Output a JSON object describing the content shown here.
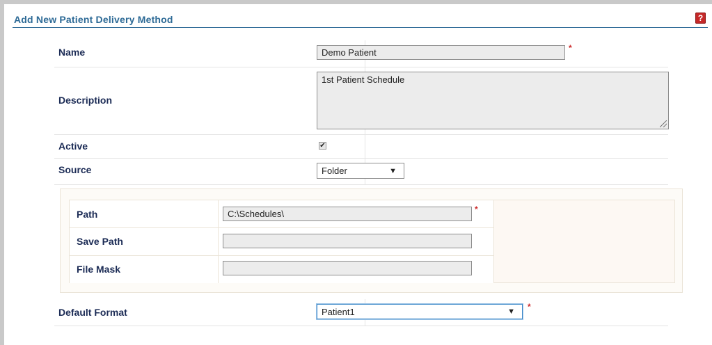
{
  "header": {
    "title": "Add New Patient Delivery Method",
    "help_icon": "question-mark",
    "help_glyph": "?"
  },
  "form": {
    "name": {
      "label": "Name",
      "value": "Demo Patient",
      "required": true
    },
    "description": {
      "label": "Description",
      "value": "1st Patient Schedule"
    },
    "active": {
      "label": "Active",
      "checked": true
    },
    "source": {
      "label": "Source",
      "selected": "Folder"
    },
    "path": {
      "label": "Path",
      "value": "C:\\Schedules\\",
      "required": true
    },
    "save_path": {
      "label": "Save Path",
      "value": ""
    },
    "file_mask": {
      "label": "File Mask",
      "value": ""
    },
    "default_format": {
      "label": "Default Format",
      "selected": "Patient1",
      "required": true
    }
  },
  "symbols": {
    "required": "*",
    "dropdown_arrow": "▼",
    "check": "✔"
  },
  "colors": {
    "header_text": "#2d6a96",
    "label_text": "#1b2b55",
    "required": "#cc2a2a",
    "help_icon": "#c62828"
  }
}
